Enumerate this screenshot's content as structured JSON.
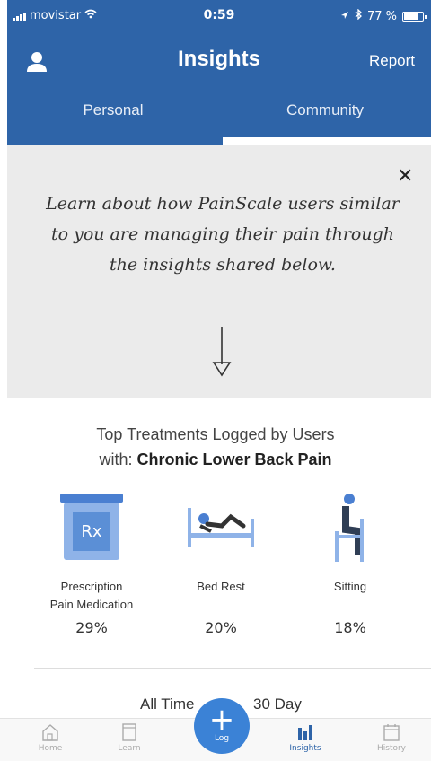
{
  "status_bar": {
    "carrier": "movistar",
    "time": "0:59",
    "battery": "77 %"
  },
  "header": {
    "title": "Insights",
    "report_label": "Report",
    "user_icon": "user-icon"
  },
  "tabs": [
    {
      "label": "Personal",
      "active": false
    },
    {
      "label": "Community",
      "active": true
    }
  ],
  "banner": {
    "text": "Learn about how PainScale users similar to you are managing their pain through the insights shared below.",
    "close_icon": "close-icon",
    "arrow_icon": "arrow-down-icon"
  },
  "section": {
    "title_prefix": "Top Treatments Logged by Users",
    "title_with": "with: ",
    "condition": "Chronic Lower Back Pain"
  },
  "treatments": [
    {
      "label_line1": "Prescription",
      "label_line2": "Pain Medication",
      "percent": "29%",
      "icon": "prescription-jar-icon"
    },
    {
      "label_line1": "Bed Rest",
      "label_line2": "",
      "percent": "20%",
      "icon": "bed-rest-icon"
    },
    {
      "label_line1": "Sitting",
      "label_line2": "",
      "percent": "18%",
      "icon": "sitting-icon"
    }
  ],
  "filters": {
    "all_time": "All Time",
    "thirty_day": "30 Day"
  },
  "tabbar": {
    "home": "Home",
    "learn": "Learn",
    "log": "Log",
    "insights": "Insights",
    "history": "History"
  },
  "colors": {
    "brand": "#2e64a8",
    "accent": "#3b82d6",
    "icon_blue": "#5b8fd6"
  }
}
